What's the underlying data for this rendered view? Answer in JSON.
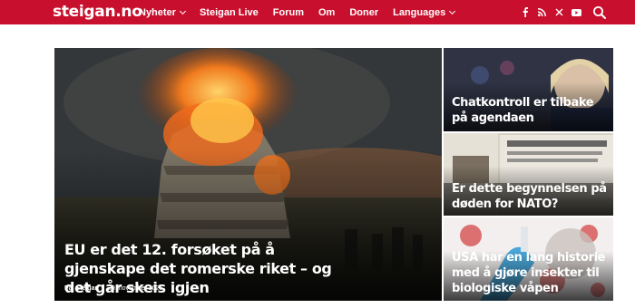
{
  "header": {
    "logo": "steigan.no",
    "nav": [
      {
        "label": "Nyheter",
        "dropdown": true
      },
      {
        "label": "Steigan Live",
        "dropdown": false
      },
      {
        "label": "Forum",
        "dropdown": false
      },
      {
        "label": "Om",
        "dropdown": false
      },
      {
        "label": "Doner",
        "dropdown": false
      },
      {
        "label": "Languages",
        "dropdown": true
      }
    ],
    "social_icons": [
      "facebook-icon",
      "rss-icon",
      "x-icon",
      "youtube-icon"
    ],
    "search_icon": "search-icon",
    "brand_color": "#c8102e"
  },
  "featured": {
    "main": {
      "title": "EU er det 12. forsøket på å gjenskape det romerske riket – og det går skeis igjen",
      "author": "Pål Steigan",
      "date": "29. november 2025"
    },
    "side": [
      {
        "title": "Chatkontroll er tilbake på agendaen"
      },
      {
        "title": "Er dette begynnelsen på døden for NATO?"
      },
      {
        "title": "USA har en lang historie med å gjøre insekter til biologiske våpen"
      }
    ]
  }
}
